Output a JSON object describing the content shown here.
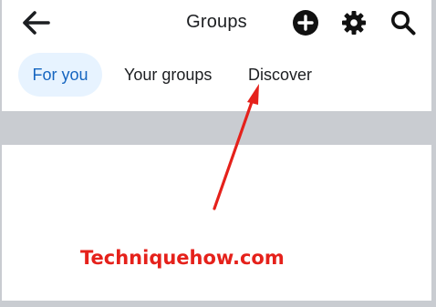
{
  "header": {
    "title": "Groups",
    "icons": [
      "back-arrow-icon",
      "plus-circle-icon",
      "gear-icon",
      "search-icon"
    ]
  },
  "tabs": [
    {
      "label": "For you",
      "selected": true
    },
    {
      "label": "Your groups",
      "selected": false
    },
    {
      "label": "Discover",
      "selected": false
    }
  ],
  "annotation": {
    "watermark": "Techniquehow.com",
    "arrow_color": "#e5211b"
  },
  "colors": {
    "accent_text": "#1565c0",
    "selected_tab_bg": "#e7f3ff",
    "divider_bar": "#c9ccd1"
  }
}
